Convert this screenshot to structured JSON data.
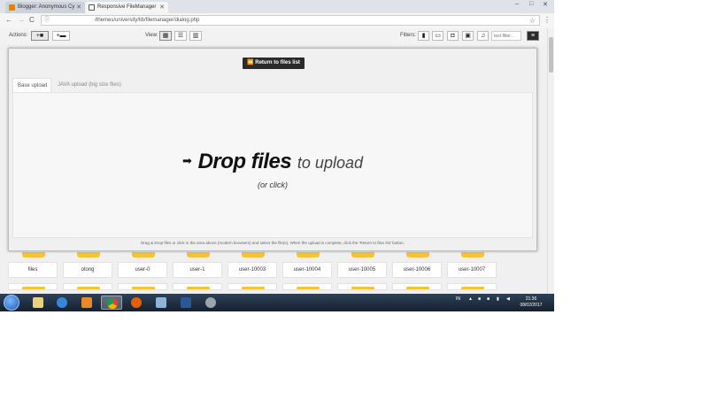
{
  "browser": {
    "tabs": [
      {
        "title": "Blogger: Anonymous Cy"
      },
      {
        "title": "Responsive FileManager"
      }
    ],
    "url": "/themes/university/lib/filemanager/dialog.php"
  },
  "toolbar": {
    "actions_label": "Actions:",
    "upload_button": "+■",
    "new_folder_button": "+▬",
    "view_label": "View:",
    "filters_label": "Filters:",
    "filter_placeholder": "text filter..."
  },
  "modal": {
    "return_button": "Return to files list",
    "tabs": [
      "Base upload",
      "JAVA upload (big size files)"
    ],
    "drop_main": "Drop files",
    "drop_to": "to upload",
    "drop_sub": "(or click)",
    "hint": "Drag & Drop files or click in the area above (modern browsers) and select the file(s). When the upload is complete, click the 'Return to files list' button."
  },
  "folders": [
    "files",
    "otong",
    "user-0",
    "user-1",
    "user-10003",
    "user-10004",
    "user-10005",
    "user-10006",
    "user-10007"
  ],
  "taskbar": {
    "lang": "IN",
    "time": "21:36",
    "date": "08/02/2017"
  },
  "colors": {
    "folder": "#f5c238",
    "return_button_bg": "#2b2b2b",
    "blogger": "#f57d00"
  }
}
